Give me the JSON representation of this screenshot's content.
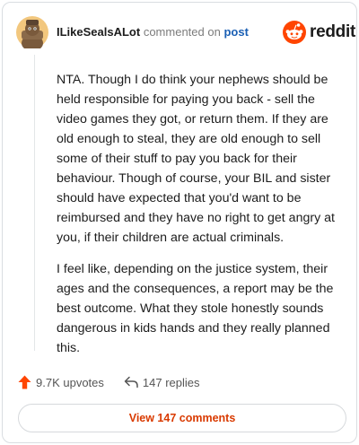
{
  "header": {
    "username": "ILikeSealsALot",
    "commented_text": "commented on",
    "post_link": "post",
    "logo_text": "reddit"
  },
  "comment": {
    "paragraphs": [
      "NTA. Though I do think your nephews should be held responsible for paying you back - sell the video games they got, or return them. If they are old enough to steal, they are old enough to sell some of their stuff to pay you back for their behaviour. Though of course, your BIL and sister should have expected that you'd want to be reimbursed and they have no right to get angry at you, if their children are actual criminals.",
      "I feel like, depending on the justice system, their ages and the consequences, a report may be the best outcome. What they stole honestly sounds dangerous in kids hands and they really planned this."
    ]
  },
  "actions": {
    "upvotes": "9.7K upvotes",
    "replies": "147 replies"
  },
  "footer": {
    "view_comments": "View 147 comments"
  },
  "colors": {
    "accent": "#d93a00",
    "upvote": "#ff4500",
    "link": "#1a5fb4"
  },
  "icons": [
    "user-avatar",
    "reddit-logo-icon",
    "upvote-arrow-icon",
    "reply-arrow-icon"
  ]
}
